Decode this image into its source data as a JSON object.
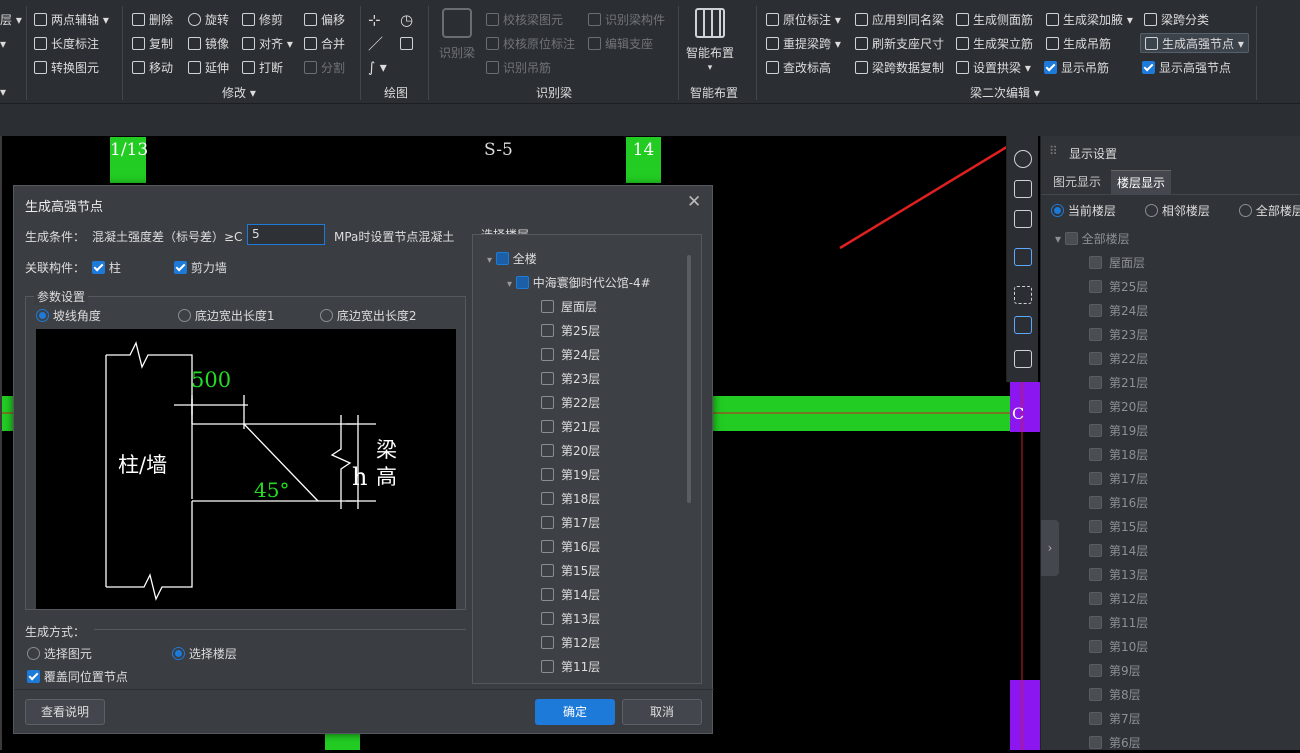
{
  "ribbon": {
    "col0": [
      "层",
      "",
      ""
    ],
    "col1": [
      "两点辅轴",
      "长度标注",
      "转换图元"
    ],
    "modify": {
      "col1": [
        "删除",
        "复制",
        "移动"
      ],
      "col2": [
        "旋转",
        "镜像",
        "延伸"
      ],
      "col3": [
        "修剪",
        "对齐",
        "打断"
      ],
      "col4": [
        "偏移",
        "合并",
        "分割"
      ],
      "label": "修改"
    },
    "draw_label": "绘图",
    "recognize": {
      "big": "识别梁",
      "col1": [
        "校核梁图元",
        "校核原位标注",
        "识别吊筋"
      ],
      "col2": [
        "识别梁构件",
        "编辑支座"
      ],
      "label": "识别梁"
    },
    "smart": {
      "big": "智能布置",
      "label": "智能布置"
    },
    "beam2": {
      "col1": [
        "原位标注",
        "重提梁跨",
        "查改标高"
      ],
      "col2": [
        "应用到同名梁",
        "刷新支座尺寸",
        "梁跨数据复制"
      ],
      "col3": [
        "生成侧面筋",
        "生成架立筋",
        "设置拱梁"
      ],
      "col4": [
        "生成梁加腋",
        "生成吊筋",
        "显示吊筋"
      ],
      "col5": [
        "梁跨分类",
        "生成高强节点",
        "显示高强节点"
      ],
      "label": "梁二次编辑"
    }
  },
  "canvas": {
    "axis_labels": [
      "1/13",
      "S-5",
      "14"
    ],
    "beam_label": "C"
  },
  "dialog": {
    "title": "生成高强节点",
    "condition_label": "生成条件：",
    "condition_text": "混凝土强度差（标号差）≥C",
    "condition_value": "5",
    "condition_suffix": "MPa时设置节点混凝土",
    "related_label": "关联构件：",
    "related_items": [
      "柱",
      "剪力墙"
    ],
    "params_label": "参数设置",
    "param_options": [
      "坡线角度",
      "底边宽出长度1",
      "底边宽出长度2"
    ],
    "diagram": {
      "width": "500",
      "angle": "45°",
      "column": "柱/墙",
      "h": "h",
      "beam_height_1": "梁",
      "beam_height_2": "高"
    },
    "method_label": "生成方式：",
    "method_options": [
      "选择图元",
      "选择楼层"
    ],
    "overwrite_label": "覆盖同位置节点",
    "help_button": "查看说明",
    "ok_button": "确定",
    "cancel_button": "取消",
    "floor_select_label": "选择楼层",
    "tree_all": "全楼",
    "tree_project": "中海寰御时代公馆-4#",
    "floors": [
      "屋面层",
      "第25层",
      "第24层",
      "第23层",
      "第22层",
      "第21层",
      "第20层",
      "第19层",
      "第18层",
      "第17层",
      "第16层",
      "第15层",
      "第14层",
      "第13层",
      "第12层",
      "第11层"
    ]
  },
  "right_panel": {
    "title": "显示设置",
    "tabs": [
      "图元显示",
      "楼层显示"
    ],
    "scope_options": [
      "当前楼层",
      "相邻楼层",
      "全部楼层"
    ],
    "tree_root": "全部楼层",
    "floors": [
      "屋面层",
      "第25层",
      "第24层",
      "第23层",
      "第22层",
      "第21层",
      "第20层",
      "第19层",
      "第18层",
      "第17层",
      "第16层",
      "第15层",
      "第14层",
      "第13层",
      "第12层",
      "第11层",
      "第10层",
      "第9层",
      "第8层",
      "第7层",
      "第6层"
    ]
  }
}
